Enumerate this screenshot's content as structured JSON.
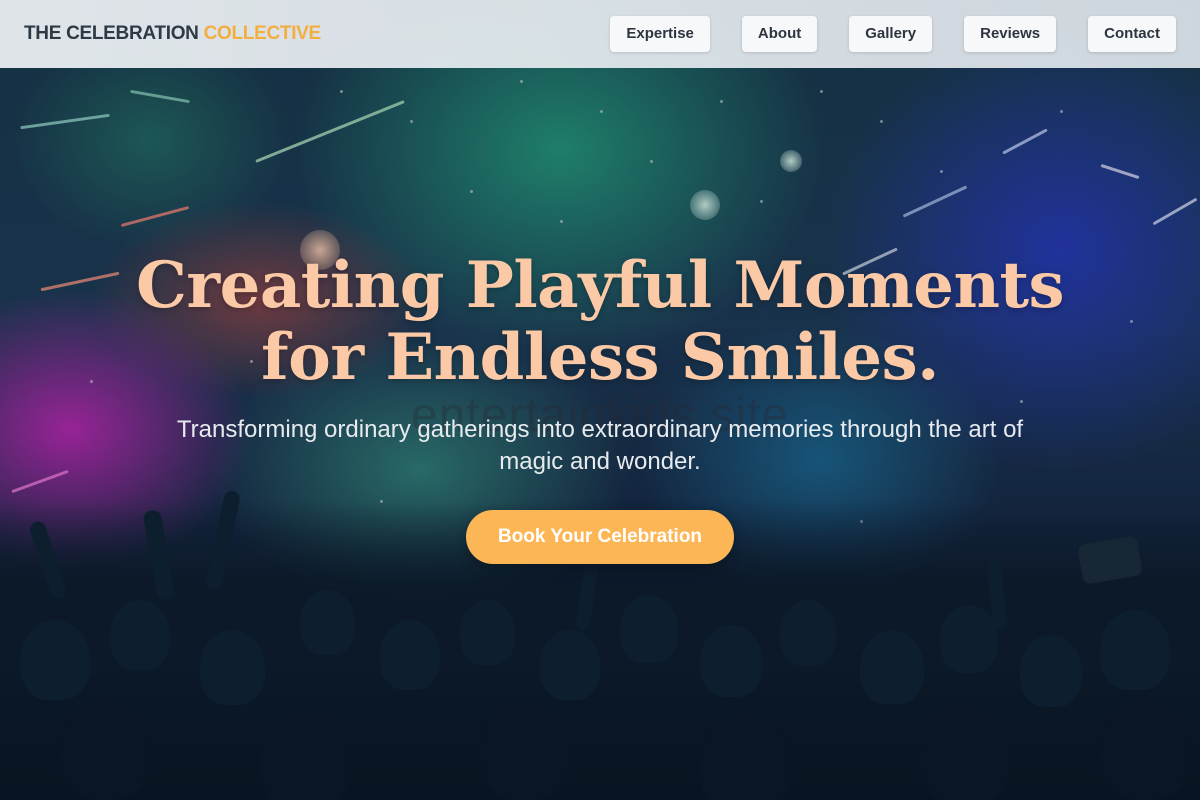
{
  "header": {
    "logo_main": "THE CELEBRATION",
    "logo_accent": "COLLECTIVE",
    "nav": [
      {
        "label": "Expertise"
      },
      {
        "label": "About"
      },
      {
        "label": "Gallery"
      },
      {
        "label": "Reviews"
      },
      {
        "label": "Contact"
      }
    ]
  },
  "hero": {
    "title_line1": "Creating Playful Moments",
    "title_line2": "for Endless Smiles.",
    "watermark": "entertainkids.site",
    "subtitle": "Transforming ordinary gatherings into extraordinary memories through the art of magic and wonder.",
    "cta_label": "Book Your Celebration"
  },
  "colors": {
    "accent": "#f3ae40",
    "cta_background": "#fcb655",
    "title": "#fcc9a6",
    "header_background": "#eef2f5"
  },
  "background_image": "concert-crowd-with-stage-lights"
}
